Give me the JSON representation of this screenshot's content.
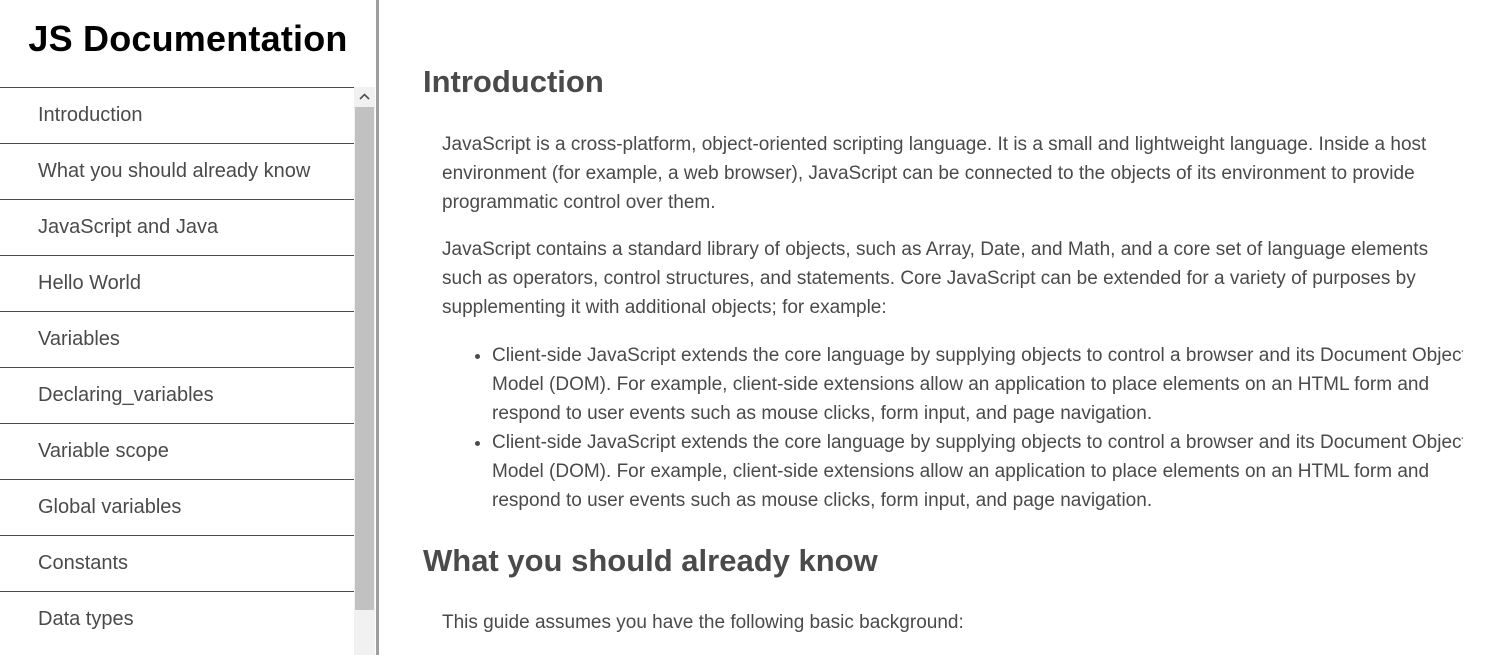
{
  "navbar": {
    "title": "JS Documentation",
    "items": [
      "Introduction",
      "What you should already know",
      "JavaScript and Java",
      "Hello World",
      "Variables",
      "Declaring_variables",
      "Variable scope",
      "Global variables",
      "Constants",
      "Data types"
    ]
  },
  "main": {
    "sections": [
      {
        "header": "Introduction",
        "paragraphs": [
          "JavaScript is a cross-platform, object-oriented scripting language. It is a small and lightweight language. Inside a host environment (for example, a web browser), JavaScript can be connected to the objects of its environment to provide programmatic control over them.",
          "JavaScript contains a standard library of objects, such as Array, Date, and Math, and a core set of language elements such as operators, control structures, and statements. Core JavaScript can be extended for a variety of purposes by supplementing it with additional objects; for example:"
        ],
        "bullets": [
          "Client-side JavaScript extends the core language by supplying objects to control a browser and its Document Object Model (DOM). For example, client-side extensions allow an application to place elements on an HTML form and respond to user events such as mouse clicks, form input, and page navigation.",
          "Client-side JavaScript extends the core language by supplying objects to control a browser and its Document Object Model (DOM). For example, client-side extensions allow an application to place elements on an HTML form and respond to user events such as mouse clicks, form input, and page navigation."
        ]
      },
      {
        "header": "What you should already know",
        "paragraphs": [
          "This guide assumes you have the following basic background:"
        ]
      }
    ]
  }
}
